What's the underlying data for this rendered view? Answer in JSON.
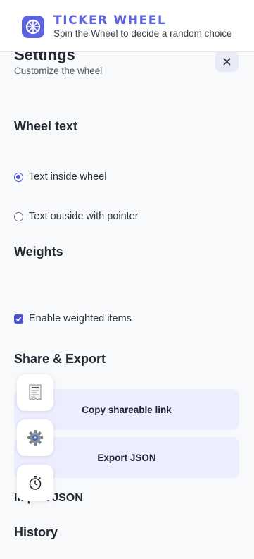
{
  "header": {
    "title": "TICKER WHEEL",
    "subtitle": "Spin the Wheel to decide a random choice",
    "logo_icon": "wheel-logo-icon",
    "accent_color": "#5b63e0"
  },
  "settings": {
    "title": "Settings",
    "subtitle": "Customize the wheel",
    "close_icon": "close-icon",
    "wheel_text": {
      "heading": "Wheel text",
      "options": [
        {
          "label": "Text inside wheel",
          "selected": true
        },
        {
          "label": "Text outside with pointer",
          "selected": false
        }
      ]
    },
    "weights": {
      "heading": "Weights",
      "enable_label": "Enable weighted items",
      "enabled": true
    },
    "share_export": {
      "heading": "Share & Export",
      "copy_link_label": "Copy shareable link",
      "export_json_label": "Export JSON",
      "import_json_label": "Import JSON"
    },
    "history": {
      "heading": "History"
    }
  },
  "floating_tools": [
    {
      "name": "receipt-icon"
    },
    {
      "name": "gear-icon"
    },
    {
      "name": "stopwatch-icon"
    }
  ]
}
